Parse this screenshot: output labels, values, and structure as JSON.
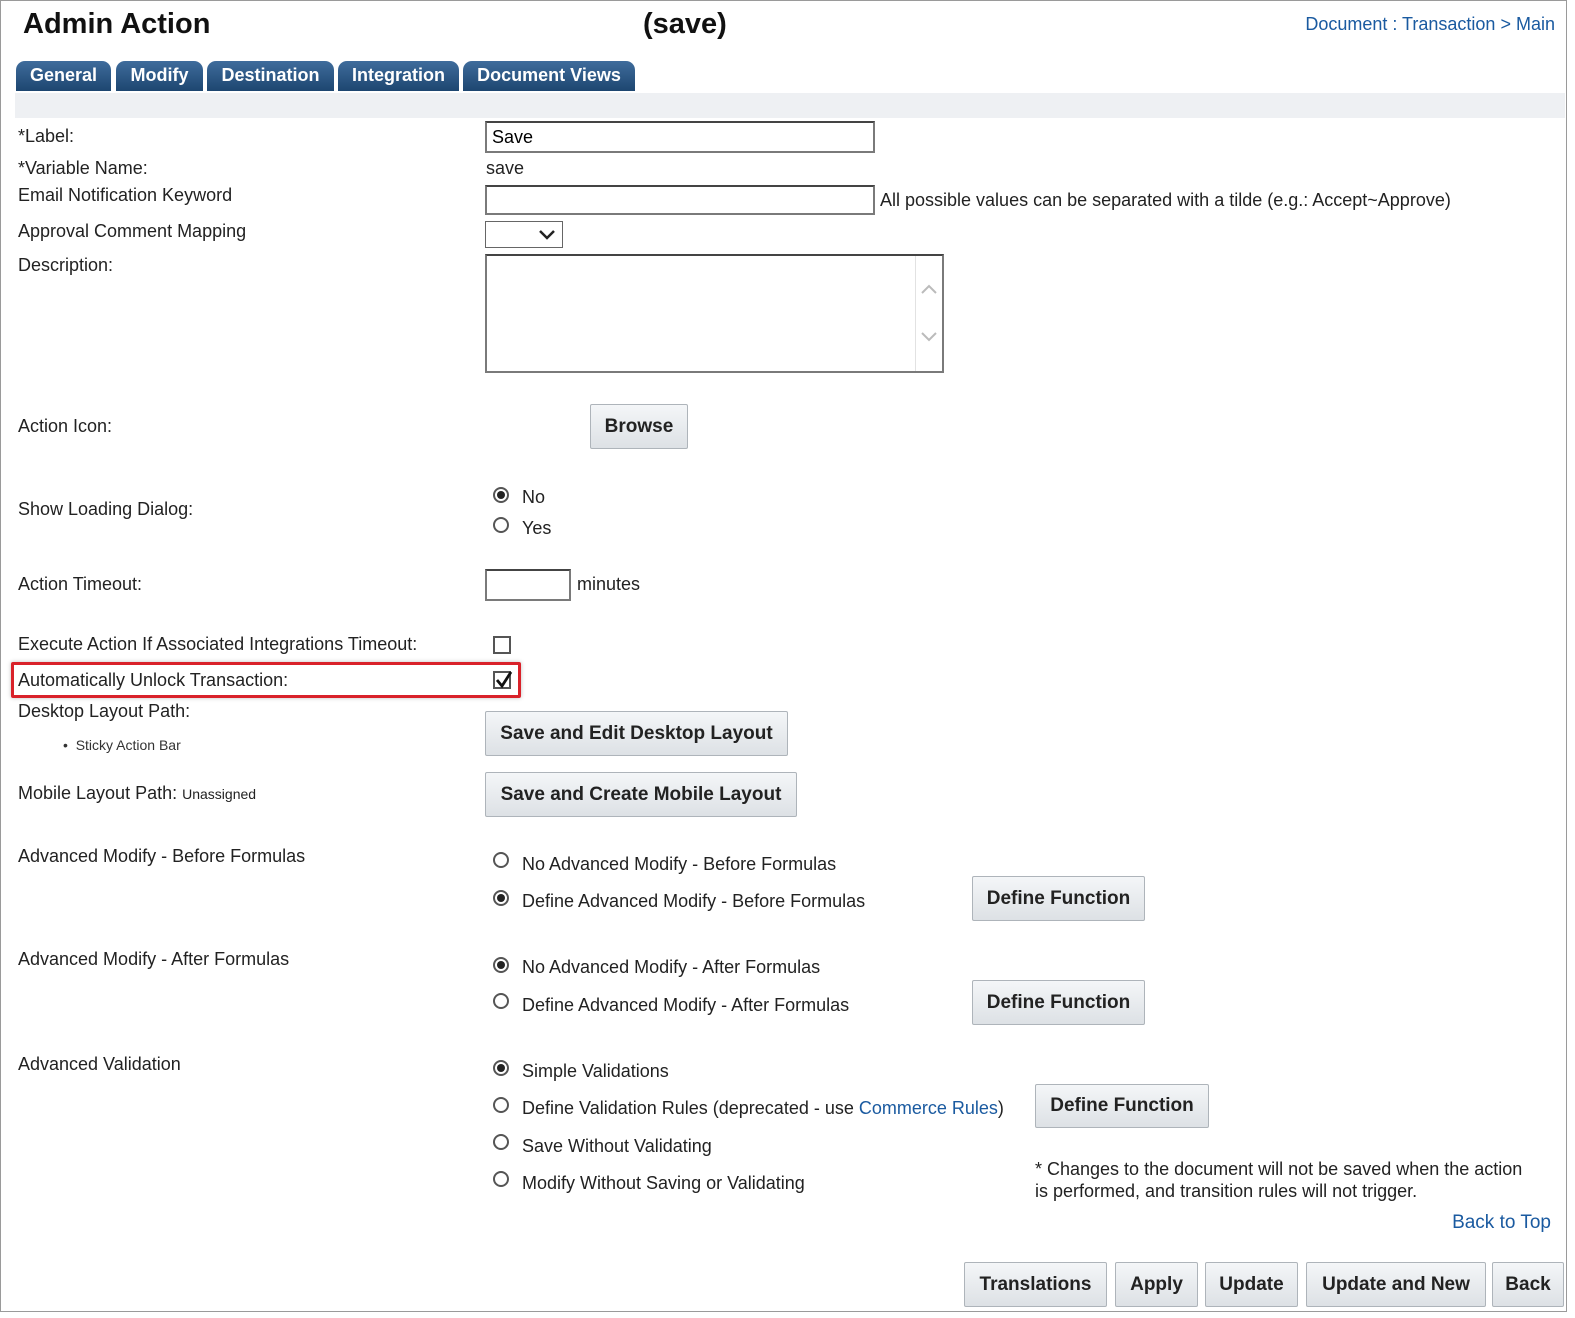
{
  "header": {
    "title": "Admin Action",
    "subtitle": "(save)",
    "breadcrumb_document": "Document : Transaction",
    "breadcrumb_sep": ">",
    "breadcrumb_main": "Main"
  },
  "tabs": [
    "General",
    "Modify",
    "Destination",
    "Integration",
    "Document Views"
  ],
  "form": {
    "label_label": "*Label:",
    "label_value": "Save",
    "varname_label": "*Variable Name:",
    "varname_value": "save",
    "email_label": "Email Notification Keyword",
    "email_value": "",
    "email_hint": "All possible values can be separated with a tilde (e.g.: Accept~Approve)",
    "approval_label": "Approval Comment Mapping",
    "approval_value": "",
    "description_label": "Description:",
    "description_value": "",
    "action_icon_label": "Action Icon:",
    "browse_button": "Browse",
    "show_loading_label": "Show Loading Dialog:",
    "show_loading_options": [
      "No",
      "Yes"
    ],
    "show_loading_selected": "No",
    "timeout_label": "Action Timeout:",
    "timeout_value": "",
    "timeout_unit": "minutes",
    "execute_label": "Execute Action If Associated Integrations Timeout:",
    "execute_checked": false,
    "unlock_label": "Automatically Unlock Transaction:",
    "unlock_checked": true,
    "desktop_layout_label": "Desktop Layout Path:",
    "desktop_layout_item": "Sticky Action Bar",
    "desktop_layout_button": "Save and Edit Desktop Layout",
    "mobile_layout_label": "Mobile Layout Path:",
    "mobile_layout_value": "Unassigned",
    "mobile_layout_button": "Save and Create Mobile Layout",
    "adv_before_label": "Advanced Modify - Before Formulas",
    "adv_before_options": [
      "No Advanced Modify - Before Formulas",
      "Define Advanced Modify - Before Formulas"
    ],
    "adv_before_selected": 1,
    "adv_after_label": "Advanced Modify - After Formulas",
    "adv_after_options": [
      "No Advanced Modify - After Formulas",
      "Define Advanced Modify - After Formulas"
    ],
    "adv_after_selected": 0,
    "define_function_button": "Define Function",
    "adv_validation_label": "Advanced Validation",
    "validation_option_1": "Simple Validations",
    "validation_option_2_prefix": "Define Validation Rules (deprecated - use ",
    "validation_option_2_link": "Commerce Rules",
    "validation_option_2_suffix": ")",
    "validation_option_3": "Save Without Validating",
    "validation_option_4": "Modify Without Saving or Validating",
    "validation_selected": 0,
    "note_line1": "* Changes to the document will not be saved when the action",
    "note_line2": "is performed, and transition rules will not trigger."
  },
  "footer": {
    "back_to_top": "Back to Top",
    "buttons": [
      "Translations",
      "Apply",
      "Update",
      "Update and New",
      "Back"
    ]
  }
}
